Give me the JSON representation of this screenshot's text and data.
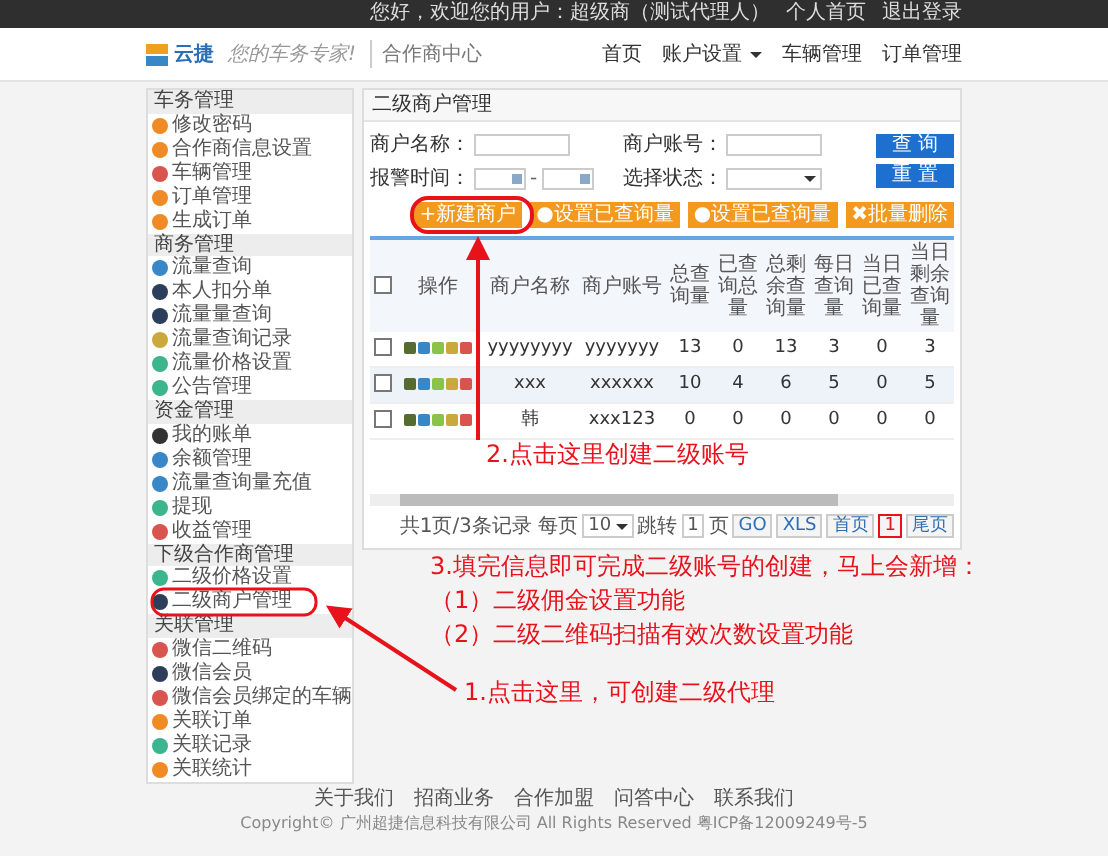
{
  "top_bar": {
    "greeting": "您好，欢迎您的用户：超级商（测试代理人）",
    "links": [
      "个人首页",
      "退出登录"
    ]
  },
  "header": {
    "logo": "云捷",
    "slogan": "您的车务专家!",
    "title": "合作商中心",
    "nav": [
      {
        "label": "首页",
        "dropdown": false
      },
      {
        "label": "账户设置",
        "dropdown": true
      },
      {
        "label": "车辆管理",
        "dropdown": false
      },
      {
        "label": "订单管理",
        "dropdown": false
      }
    ]
  },
  "sidebar": {
    "sections": [
      {
        "title": "车务管理",
        "items": [
          {
            "label": "修改密码",
            "color": "#f08a24"
          },
          {
            "label": "合作商信息设置",
            "color": "#f08a24"
          },
          {
            "label": "车辆管理",
            "color": "#d9534f"
          },
          {
            "label": "订单管理",
            "color": "#f08a24"
          },
          {
            "label": "生成订单",
            "color": "#f08a24"
          }
        ]
      },
      {
        "title": "商务管理",
        "items": [
          {
            "label": "流量查询",
            "color": "#3a87c8"
          },
          {
            "label": "本人扣分单",
            "color": "#2c3e5a"
          },
          {
            "label": "流量量查询",
            "color": "#2c3e5a"
          },
          {
            "label": "流量查询记录",
            "color": "#c9a93b"
          },
          {
            "label": "流量价格设置",
            "color": "#3bb58e"
          },
          {
            "label": "公告管理",
            "color": "#3bb58e"
          }
        ]
      },
      {
        "title": "资金管理",
        "items": [
          {
            "label": "我的账单",
            "color": "#333333"
          },
          {
            "label": "余额管理",
            "color": "#3a87c8"
          },
          {
            "label": "流量查询量充值",
            "color": "#3a87c8"
          },
          {
            "label": "提现",
            "color": "#3bb58e"
          },
          {
            "label": "收益管理",
            "color": "#d9534f"
          }
        ]
      },
      {
        "title": "下级合作商管理",
        "items": [
          {
            "label": "二级价格设置",
            "color": "#3bb58e"
          },
          {
            "label": "二级商户管理",
            "color": "#2c3e5a"
          }
        ]
      },
      {
        "title": "关联管理",
        "items": [
          {
            "label": "微信二维码",
            "color": "#d9534f"
          },
          {
            "label": "微信会员",
            "color": "#2c3e5a"
          },
          {
            "label": "微信会员绑定的车辆",
            "color": "#d9534f"
          },
          {
            "label": "关联订单",
            "color": "#f08a24"
          },
          {
            "label": "关联记录",
            "color": "#3bb58e"
          },
          {
            "label": "关联统计",
            "color": "#f08a24"
          }
        ]
      }
    ]
  },
  "panel": {
    "title": "二级商户管理",
    "filters": [
      {
        "kind": "text",
        "label": "商户名称："
      },
      {
        "kind": "text",
        "label": "商户账号："
      },
      {
        "kind": "date_range",
        "label": "报警时间：",
        "separator": "-"
      },
      {
        "kind": "select",
        "label": "选择状态："
      }
    ],
    "search_buttons": [
      "查 询",
      "重 置"
    ],
    "toolbar": [
      "+新建商户",
      "●设置已查询量",
      "●设置已查询量",
      "✖批量删除"
    ],
    "table": {
      "all_checked": false,
      "columns": [
        "",
        "操作",
        "商户名称",
        "商户账号",
        "总查询量",
        "已查询总量",
        "总剩余查询量",
        "每日查询量",
        "当日已查询量",
        "当日剩余查询量"
      ],
      "rows": [
        {
          "checked": false,
          "cells": [
            "",
            "",
            "yyyyyyyy",
            "yyyyyyy",
            "13",
            "0",
            "13",
            "3",
            "0",
            "3"
          ]
        },
        {
          "checked": false,
          "cells": [
            "",
            "",
            "xxx",
            "xxxxxx",
            "10",
            "4",
            "6",
            "5",
            "0",
            "5"
          ]
        },
        {
          "checked": false,
          "cells": [
            "",
            "",
            "韩",
            "xxx123",
            "0",
            "0",
            "0",
            "0",
            "0",
            "0"
          ]
        }
      ]
    },
    "pagination": {
      "summary": "共1页/3条记录 每页",
      "page_size": "10",
      "jump_label": "跳转",
      "jump_value": "1",
      "page_unit": "页",
      "buttons": [
        "GO",
        "XLS",
        "首页"
      ],
      "current": "1",
      "last": "尾页"
    }
  },
  "annotations": [
    "2.点击这里创建二级账号",
    "3.填完信息即可完成二级账号的创建，马上会新增：",
    "（1）二级佣金设置功能",
    "（2）二级二维码扫描有效次数设置功能",
    "1.点击这里，可创建二级代理"
  ],
  "footer": {
    "links": [
      "关于我们",
      "招商业务",
      "合作加盟",
      "问答中心",
      "联系我们"
    ],
    "copyright": "Copyright© 广州超捷信息科技有限公司 All Rights Reserved 粤ICP备12009249号-5"
  }
}
